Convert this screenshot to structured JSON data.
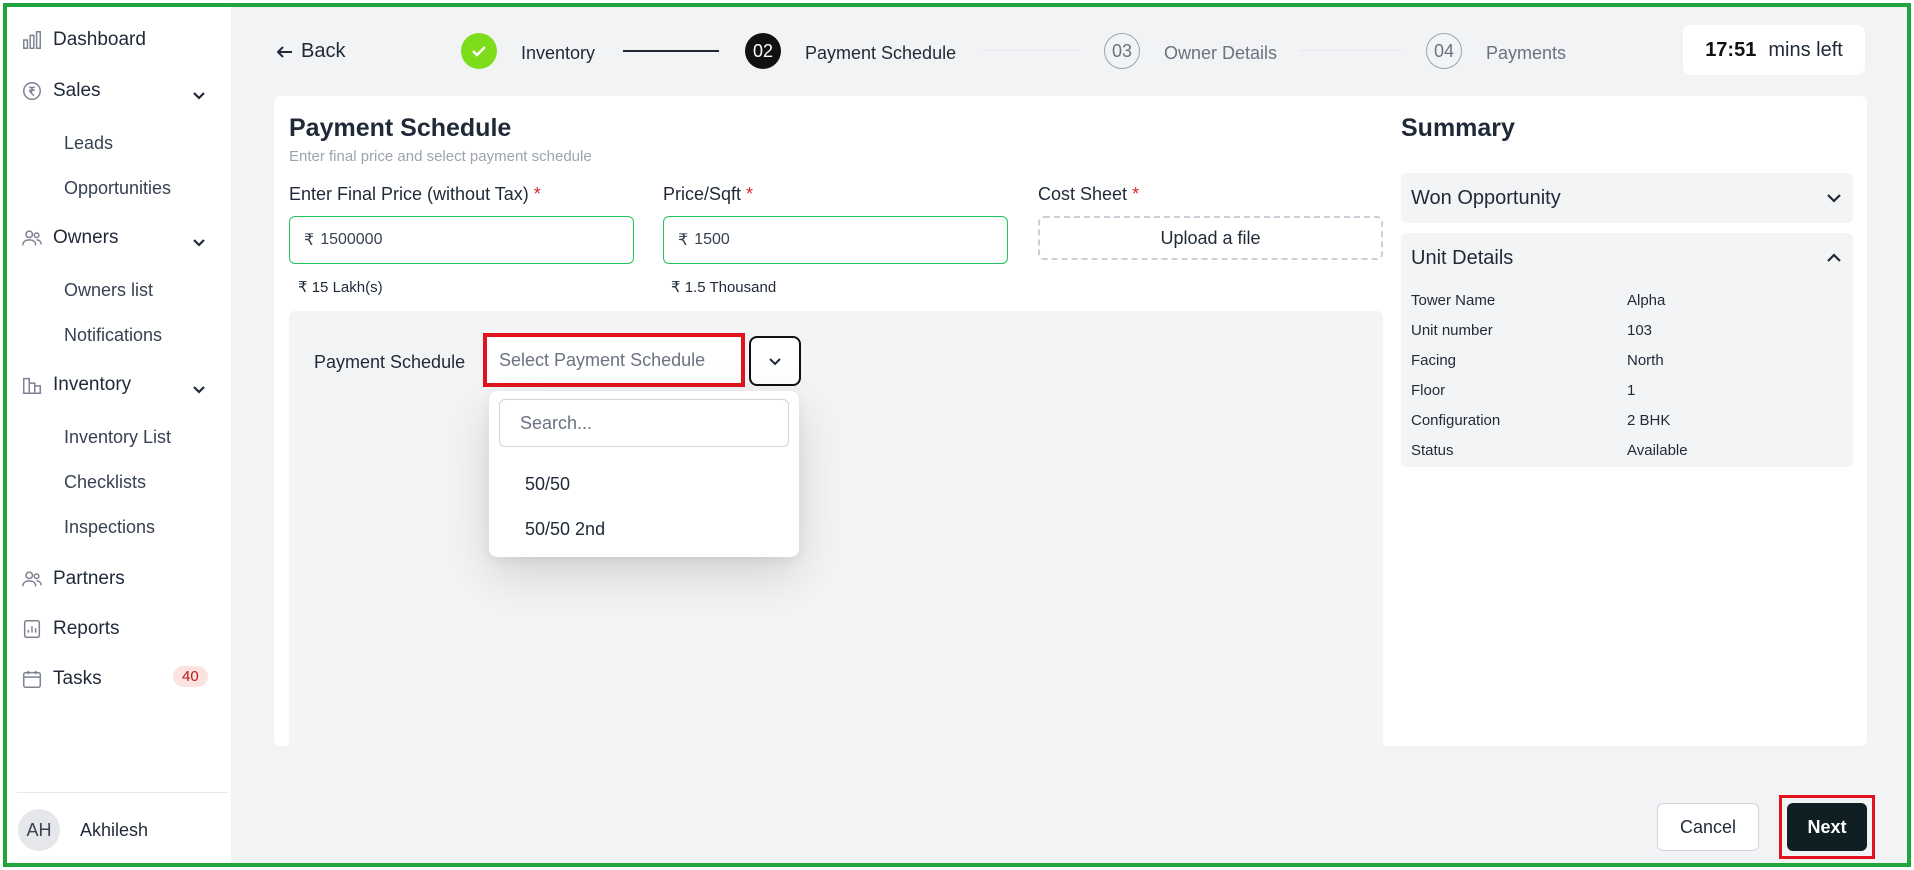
{
  "sidebar": {
    "dashboard": "Dashboard",
    "sales": "Sales",
    "leads": "Leads",
    "opportunities": "Opportunities",
    "owners": "Owners",
    "owners_list": "Owners list",
    "notifications": "Notifications",
    "inventory": "Inventory",
    "inventory_list": "Inventory List",
    "checklists": "Checklists",
    "inspections": "Inspections",
    "partners": "Partners",
    "reports": "Reports",
    "tasks": "Tasks",
    "tasks_badge": "40",
    "user_initials": "AH",
    "user_name": "Akhilesh"
  },
  "header": {
    "back_label": "Back",
    "steps": [
      {
        "number": "",
        "label": "Inventory",
        "state": "done"
      },
      {
        "number": "02",
        "label": "Payment Schedule",
        "state": "active"
      },
      {
        "number": "03",
        "label": "Owner Details",
        "state": "pending"
      },
      {
        "number": "04",
        "label": "Payments",
        "state": "pending"
      }
    ],
    "timer_value": "17:51",
    "timer_suffix": "mins left"
  },
  "form": {
    "title": "Payment Schedule",
    "subtitle": "Enter final price and select payment schedule",
    "final_price_label": "Enter Final Price (without Tax)",
    "final_price_value": "1500000",
    "final_price_helper": "₹ 15 Lakh(s)",
    "price_sqft_label": "Price/Sqft",
    "price_sqft_value": "1500",
    "price_sqft_helper": "₹ 1.5 Thousand",
    "cost_sheet_label": "Cost Sheet",
    "upload_label": "Upload a file",
    "required_mark": "*",
    "currency_symbol": "₹",
    "payment_schedule_label": "Payment Schedule",
    "payment_schedule_placeholder": "Select Payment Schedule",
    "search_placeholder": "Search...",
    "options": [
      "50/50",
      "50/50 2nd"
    ]
  },
  "summary": {
    "title": "Summary",
    "won_opportunity": "Won Opportunity",
    "unit_details": "Unit Details",
    "rows": [
      {
        "key": "Tower Name",
        "value": "Alpha"
      },
      {
        "key": "Unit number",
        "value": "103"
      },
      {
        "key": "Facing",
        "value": "North"
      },
      {
        "key": "Floor",
        "value": "1"
      },
      {
        "key": "Configuration",
        "value": "2 BHK"
      },
      {
        "key": "Status",
        "value": "Available"
      }
    ]
  },
  "footer": {
    "cancel_label": "Cancel",
    "next_label": "Next"
  },
  "colors": {
    "frame_border": "#1fa53b",
    "highlight_border": "#e1141e",
    "step_done": "#7ddd1b",
    "input_border": "#22c55e",
    "next_button": "#0f1f24",
    "badge_bg": "#fde2e2"
  }
}
